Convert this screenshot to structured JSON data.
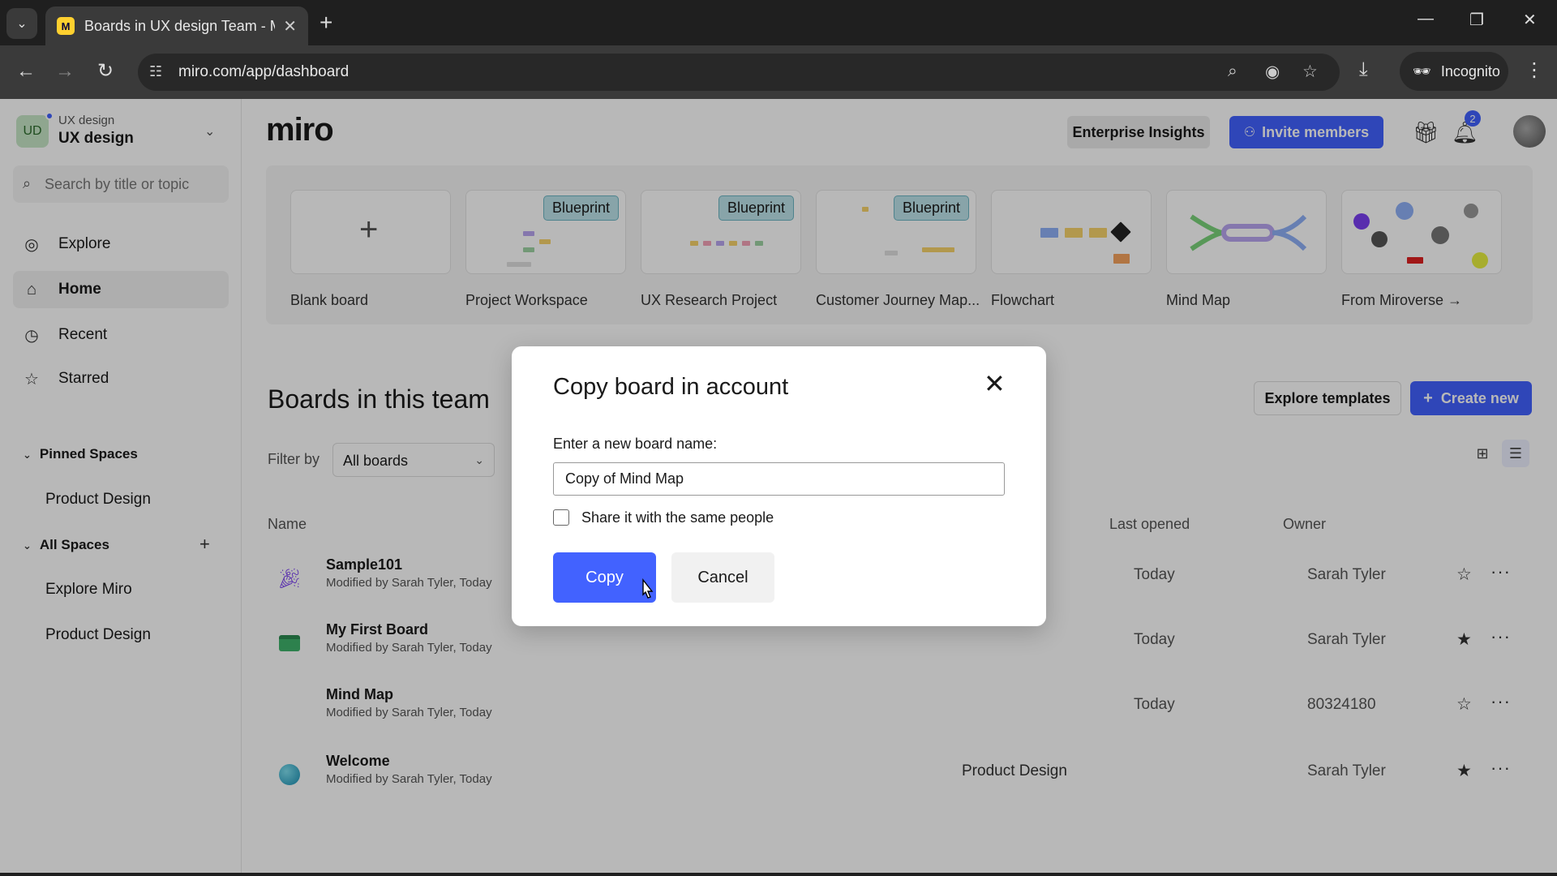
{
  "browser": {
    "tab_title": "Boards in UX design Team - Mir",
    "tab_favicon": "M",
    "url": "miro.com/app/dashboard",
    "incognito_label": "Incognito"
  },
  "sidebar": {
    "team_initials": "UD",
    "team_sub": "UX design",
    "team_name": "UX design",
    "search_placeholder": "Search by title or topic",
    "nav": [
      {
        "label": "Explore",
        "icon": "compass-icon"
      },
      {
        "label": "Home",
        "icon": "home-icon"
      },
      {
        "label": "Recent",
        "icon": "clock-icon"
      },
      {
        "label": "Starred",
        "icon": "star-icon"
      }
    ],
    "pinned_title": "Pinned Spaces",
    "pinned_items": [
      "Product Design"
    ],
    "all_title": "All Spaces",
    "all_items": [
      "Explore Miro",
      "Product Design"
    ]
  },
  "header": {
    "logo": "miro",
    "enterprise_label": "Enterprise Insights",
    "invite_label": "Invite members",
    "notification_count": "2"
  },
  "templates": [
    {
      "label": "Blank board",
      "badge": ""
    },
    {
      "label": "Project Workspace",
      "badge": "Blueprint"
    },
    {
      "label": "UX Research Project",
      "badge": "Blueprint"
    },
    {
      "label": "Customer Journey Map...",
      "badge": "Blueprint"
    },
    {
      "label": "Flowchart",
      "badge": ""
    },
    {
      "label": "Mind Map",
      "badge": ""
    },
    {
      "label": "From Miroverse →",
      "badge": ""
    }
  ],
  "boards_section": {
    "title": "Boards in this team",
    "filter_label": "Filter by",
    "filter_value": "All boards",
    "explore_label": "Explore templates",
    "create_label": "Create new",
    "columns": {
      "name": "Name",
      "last_opened": "Last opened",
      "owner": "Owner"
    }
  },
  "boards": [
    {
      "name": "Sample101",
      "modified": "Modified by Sarah Tyler, Today",
      "space": "",
      "opened": "Today",
      "owner": "Sarah Tyler",
      "starred": false,
      "thumb": "party-icon"
    },
    {
      "name": "My First Board",
      "modified": "Modified by Sarah Tyler, Today",
      "space": "",
      "opened": "Today",
      "owner": "Sarah Tyler",
      "starred": true,
      "thumb": "board-icon"
    },
    {
      "name": "Mind Map",
      "modified": "Modified by Sarah Tyler, Today",
      "space": "",
      "opened": "Today",
      "owner": "80324180",
      "starred": false,
      "thumb": ""
    },
    {
      "name": "Welcome",
      "modified": "Modified by Sarah Tyler, Today",
      "space": "Product Design",
      "opened": "",
      "owner": "Sarah Tyler",
      "starred": true,
      "thumb": "globe-icon"
    }
  ],
  "modal": {
    "title": "Copy board in account",
    "field_label": "Enter a new board name:",
    "field_value": "Copy of Mind Map",
    "checkbox_label": "Share it with the same people",
    "copy_label": "Copy",
    "cancel_label": "Cancel"
  },
  "colors": {
    "accent": "#4262ff",
    "blueprint_badge": "#bde3ea"
  }
}
